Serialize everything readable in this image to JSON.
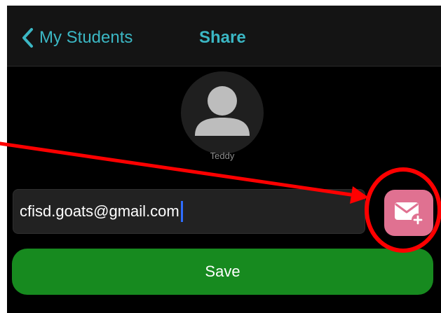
{
  "navbar": {
    "back_label": "My Students",
    "back_icon": "chevron-left-icon",
    "title": "Share"
  },
  "student": {
    "avatar_icon": "person-icon",
    "name": "Teddy"
  },
  "email_field": {
    "value": "cfisd.goats@gmail.com"
  },
  "add_email_button": {
    "icon": "envelope-plus-icon"
  },
  "save_button": {
    "label": "Save"
  },
  "colors": {
    "accent": "#3bb7c4",
    "save_green": "#178a1f",
    "add_button_pink": "#e07191",
    "annotation_red": "#ff0000"
  }
}
